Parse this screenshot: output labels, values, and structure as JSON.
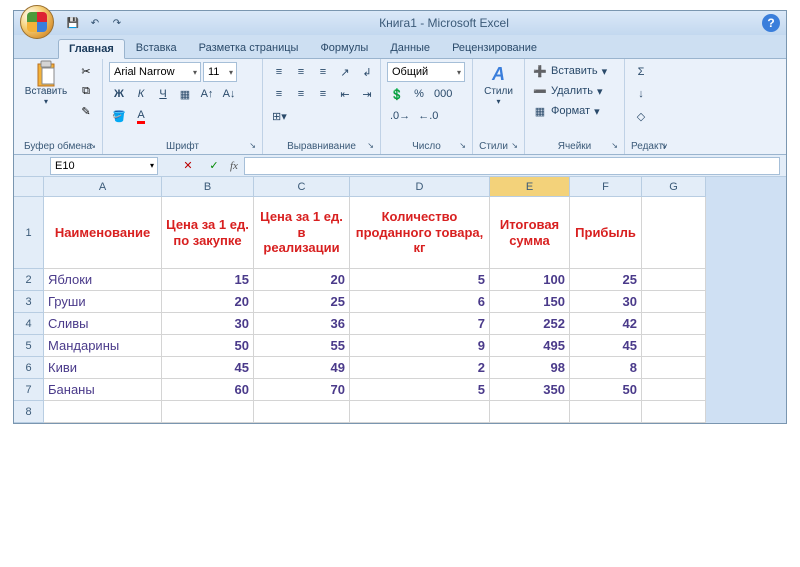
{
  "title": "Книга1 - Microsoft Excel",
  "qa": {
    "save": "💾",
    "undo": "↶",
    "redo": "↷"
  },
  "tabs": [
    "Главная",
    "Вставка",
    "Разметка страницы",
    "Формулы",
    "Данные",
    "Рецензирование"
  ],
  "active_tab": 0,
  "ribbon": {
    "clipboard": {
      "label": "Буфер обмена",
      "paste": "Вставить"
    },
    "font": {
      "label": "Шрифт",
      "name": "Arial Narrow",
      "size": "11",
      "bold": "Ж",
      "italic": "К",
      "underline": "Ч"
    },
    "align": {
      "label": "Выравнивание"
    },
    "number": {
      "label": "Число",
      "format": "Общий",
      "percent": "%",
      "thousands": "000"
    },
    "styles": {
      "label": "Стили",
      "btn": "Стили"
    },
    "cells": {
      "label": "Ячейки",
      "insert": "Вставить",
      "delete": "Удалить",
      "format": "Формат"
    },
    "editing": {
      "label": "Редакти"
    }
  },
  "namebox": "E10",
  "formula_fx": "fx",
  "columns": [
    "A",
    "B",
    "C",
    "D",
    "E",
    "F",
    "G"
  ],
  "selected_col": "E",
  "rows": [
    "1",
    "2",
    "3",
    "4",
    "5",
    "6",
    "7",
    "8"
  ],
  "header_row_height": 72,
  "data_row_height": 22,
  "headers": [
    "Наименование",
    "Цена за 1 ед. по закупке",
    "Цена за 1 ед. в реализации",
    "Количество проданного товара, кг",
    "Итоговая сумма",
    "Прибыль"
  ],
  "data": [
    {
      "name": "Яблоки",
      "buy": "15",
      "sell": "20",
      "qty": "5",
      "total": "100",
      "profit": "25"
    },
    {
      "name": "Груши",
      "buy": "20",
      "sell": "25",
      "qty": "6",
      "total": "150",
      "profit": "30"
    },
    {
      "name": "Сливы",
      "buy": "30",
      "sell": "36",
      "qty": "7",
      "total": "252",
      "profit": "42"
    },
    {
      "name": "Мандарины",
      "buy": "50",
      "sell": "55",
      "qty": "9",
      "total": "495",
      "profit": "45"
    },
    {
      "name": "Киви",
      "buy": "45",
      "sell": "49",
      "qty": "2",
      "total": "98",
      "profit": "8"
    },
    {
      "name": "Бананы",
      "buy": "60",
      "sell": "70",
      "qty": "5",
      "total": "350",
      "profit": "50"
    }
  ]
}
